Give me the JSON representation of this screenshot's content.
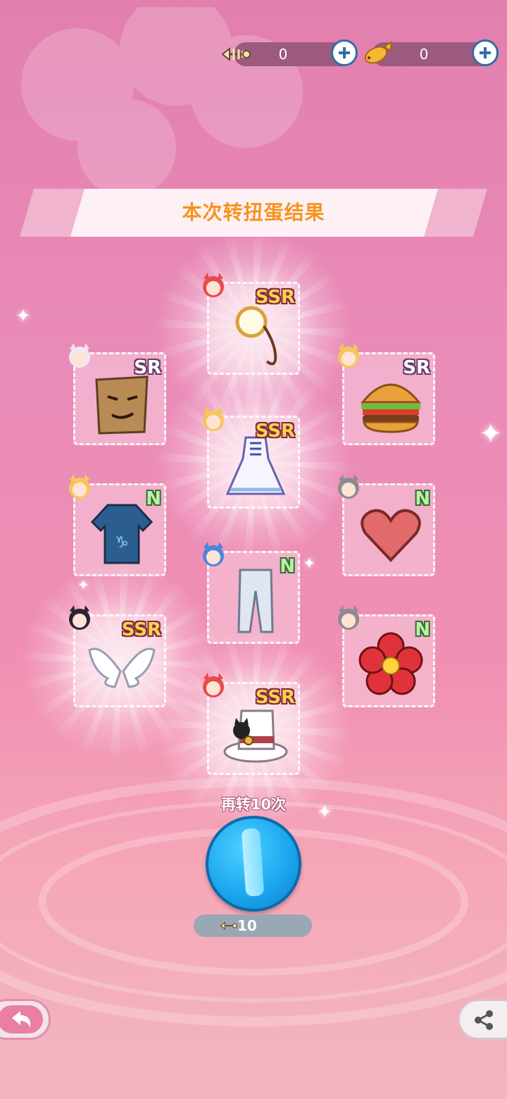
{
  "currency": [
    {
      "icon": "fishbone-icon",
      "value": "0"
    },
    {
      "icon": "gold-fish-icon",
      "value": "0"
    }
  ],
  "title": "本次转扭蛋结果",
  "results": [
    {
      "rarity": "SSR",
      "item": "monocle-icon",
      "character": "red-hair-girl"
    },
    {
      "rarity": "SR",
      "item": "paper-bag-mask-icon",
      "character": "white-hair-girl"
    },
    {
      "rarity": "SR",
      "item": "hamburger-icon",
      "character": "blonde-girl"
    },
    {
      "rarity": "SSR",
      "item": "white-dress-icon",
      "character": "blonde-girl"
    },
    {
      "rarity": "N",
      "item": "zodiac-tshirt-icon",
      "character": "blonde-girl"
    },
    {
      "rarity": "N",
      "item": "heart-icon",
      "character": "gray-hair-girl"
    },
    {
      "rarity": "N",
      "item": "white-pants-icon",
      "character": "blue-hair-boy"
    },
    {
      "rarity": "SSR",
      "item": "angel-wings-icon",
      "character": "black-hair-girl"
    },
    {
      "rarity": "N",
      "item": "red-flower-icon",
      "character": "gray-hair-girl"
    },
    {
      "rarity": "SSR",
      "item": "cat-top-hat-icon",
      "character": "red-hair-girl"
    }
  ],
  "spin_again": {
    "label": "再转10次",
    "cost": "10",
    "cost_icon": "fishbone-icon"
  },
  "colors": {
    "title": "#f7931e",
    "spin_button": "#1aa5ee",
    "ssr": "#ffcf4a",
    "n": "#b9f1a5"
  }
}
